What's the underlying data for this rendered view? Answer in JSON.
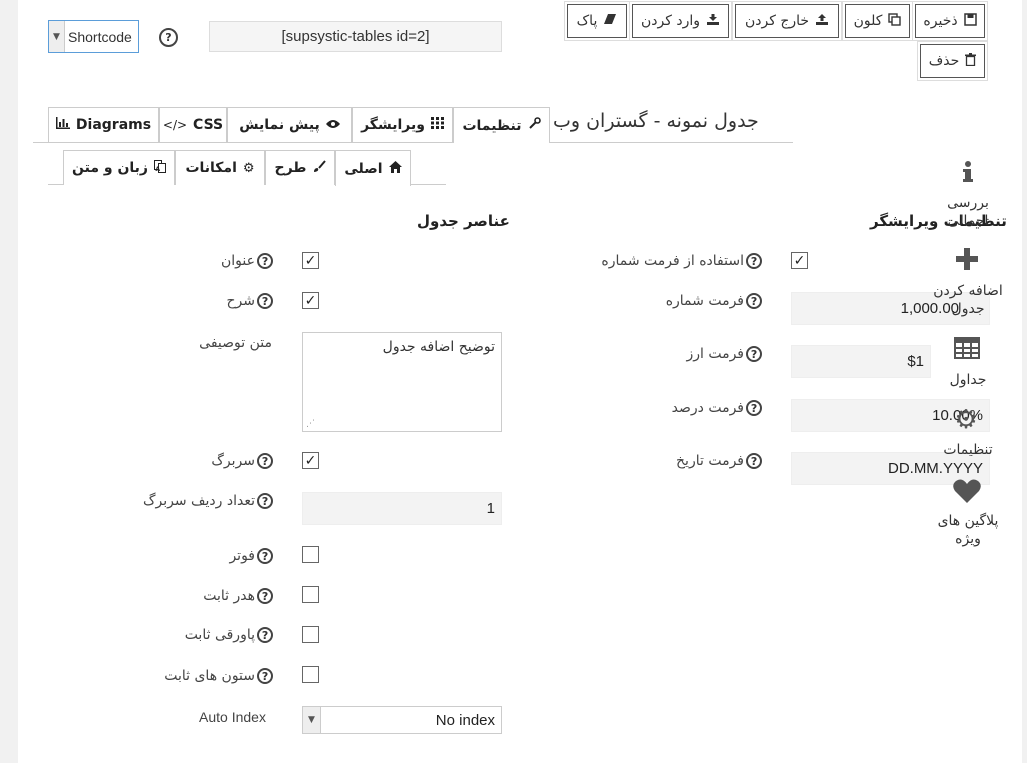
{
  "shortcode": {
    "select_value": "Shortcode",
    "value": "[supsystic-tables id=2]"
  },
  "actions": {
    "save": "ذخیره",
    "clone": "کلون",
    "export": "خارج کردن",
    "import": "وارد کردن",
    "clear": "پاک",
    "delete": "حذف"
  },
  "title": "جدول نمونه - گستران وب",
  "tabs": [
    {
      "label": "تنظیمات",
      "icon": "wrench-icon"
    },
    {
      "label": "ویرایشگر",
      "icon": "grid-icon"
    },
    {
      "label": "پیش نمایش",
      "icon": "eye-icon"
    },
    {
      "label": "CSS",
      "icon": "code-icon"
    },
    {
      "label": "Diagrams",
      "icon": "bar-chart-icon"
    }
  ],
  "subtabs": [
    {
      "label": "اصلی",
      "icon": "home-icon"
    },
    {
      "label": "طرح",
      "icon": "brush-icon"
    },
    {
      "label": "امکانات",
      "icon": "cogs-icon"
    },
    {
      "label": "زبان و متن",
      "icon": "language-icon"
    }
  ],
  "sections": {
    "table_elements": "عناصر جدول",
    "editor_settings": "تنظیمات ویرایشگر"
  },
  "table_elements": {
    "caption": {
      "label": "عنوان",
      "checked": true
    },
    "description": {
      "label": "شرح",
      "checked": true
    },
    "description_text_label": "متن توصیفی",
    "description_text_value": "توضیح اضافه جدول",
    "header": {
      "label": "سربرگ",
      "checked": true
    },
    "header_rows_label": "تعداد ردیف سربرگ",
    "header_rows_value": "1",
    "footer": {
      "label": "فوتر",
      "checked": false
    },
    "fixed_header": {
      "label": "هدر ثابت",
      "checked": false
    },
    "fixed_footer": {
      "label": "پاورقی ثابت",
      "checked": false
    },
    "fixed_columns": {
      "label": "ستون های ثابت",
      "checked": false
    },
    "auto_index_label": "Auto Index",
    "auto_index_value": "No index"
  },
  "editor_settings": {
    "use_number_format": {
      "label": "استفاده از فرمت شماره",
      "checked": true
    },
    "number_format_label": "فرمت شماره",
    "number_format_value": "1,000.00",
    "currency_format_label": "فرمت ارز",
    "currency_format_value": "$1",
    "percent_format_label": "فرمت درصد",
    "percent_format_value": "10.00%",
    "date_format_label": "فرمت تاریخ",
    "date_format_value": "DD.MM.YYYY"
  },
  "sidebar": [
    {
      "label": "بررسی اجمالی",
      "icon": "info-icon"
    },
    {
      "label": "اضافه کردن جدول",
      "icon": "plus-icon"
    },
    {
      "label": "جداول",
      "icon": "table-icon"
    },
    {
      "label": "تنظیمات",
      "icon": "gear-icon"
    },
    {
      "label": "پلاگین های ویژه",
      "icon": "heart-icon"
    }
  ]
}
